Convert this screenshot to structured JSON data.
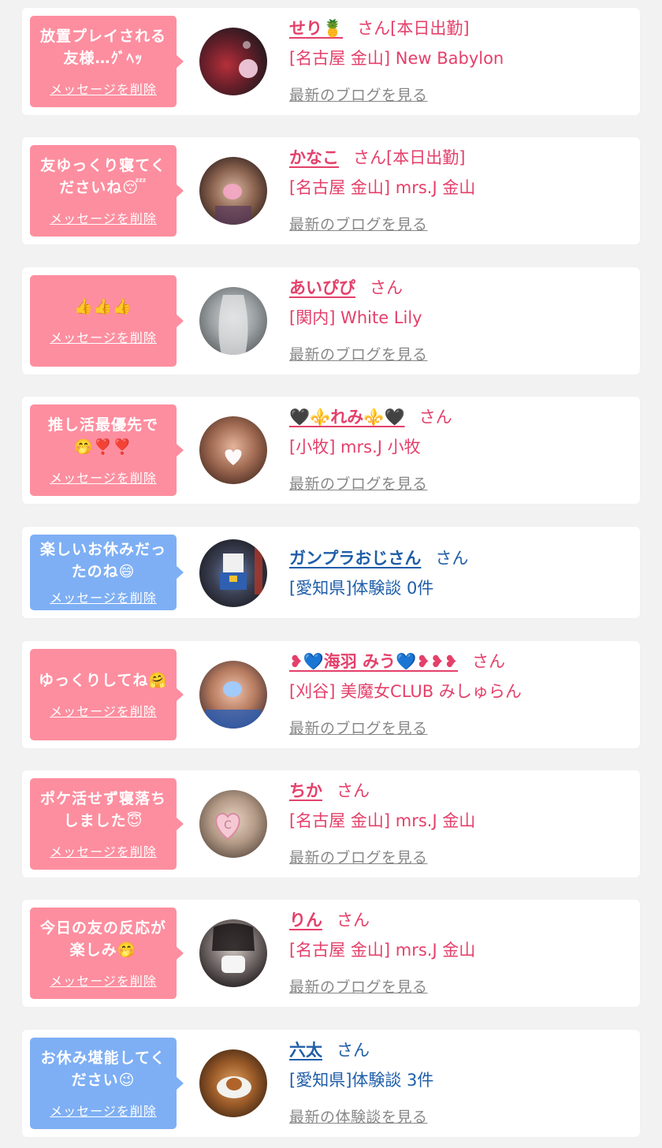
{
  "colors": {
    "pink_bubble": "#fd8e9f",
    "blue_bubble": "#7eaff4",
    "pink_text": "#e4406a",
    "blue_text": "#1f5ea8",
    "link_gray": "#888888"
  },
  "items": [
    {
      "message": [
        "放置プレイされる",
        "友様…ｸﾞﾍｯ"
      ],
      "delete_label": "メッセージを削除",
      "name": "せり🍍",
      "suffix": "さん[本日出勤]",
      "shop": "[名古屋 金山] New Babylon",
      "link": "最新のブログを見る"
    },
    {
      "message": [
        "友ゆっくり寝てく",
        "ださいね😴"
      ],
      "delete_label": "メッセージを削除",
      "name": "かなこ",
      "suffix": "さん[本日出勤]",
      "shop": "[名古屋 金山] mrs.J 金山",
      "link": "最新のブログを見る"
    },
    {
      "message": [
        "👍👍👍"
      ],
      "delete_label": "メッセージを削除",
      "name": "あいぴぴ",
      "suffix": "さん",
      "shop": "[関内] White Lily",
      "link": "最新のブログを見る"
    },
    {
      "message": [
        "推し活最優先で",
        "🤭❣️❣️"
      ],
      "delete_label": "メッセージを削除",
      "name": "🖤⚜️れみ⚜️🖤",
      "suffix": "さん",
      "shop": "[小牧] mrs.J 小牧",
      "link": "最新のブログを見る"
    },
    {
      "message": [
        "楽しいお休みだっ",
        "たのね😄"
      ],
      "delete_label": "メッセージを削除",
      "name": "ガンプラおじさん",
      "suffix": "さん",
      "shop": "[愛知県]体験談 0件",
      "link": ""
    },
    {
      "message": [
        "ゆっくりしてね🤗"
      ],
      "delete_label": "メッセージを削除",
      "name": "❥💙海羽 みう💙❥❥❥",
      "suffix": "さん",
      "shop": "[刈谷] 美魔女CLUB みしゅらん",
      "link": "最新のブログを見る"
    },
    {
      "message": [
        "ポケ活せず寝落ち",
        "しました😇"
      ],
      "delete_label": "メッセージを削除",
      "name": "ちか",
      "suffix": "さん",
      "shop": "[名古屋 金山] mrs.J 金山",
      "link": "最新のブログを見る"
    },
    {
      "message": [
        "今日の友の反応が",
        "楽しみ🤭"
      ],
      "delete_label": "メッセージを削除",
      "name": "りん",
      "suffix": "さん",
      "shop": "[名古屋 金山] mrs.J 金山",
      "link": "最新のブログを見る"
    },
    {
      "message": [
        "お休み堪能してく",
        "ださい😉"
      ],
      "delete_label": "メッセージを削除",
      "name": "六太",
      "suffix": "さん",
      "shop": "[愛知県]体験談 3件",
      "link": "最新の体験談を見る"
    }
  ]
}
